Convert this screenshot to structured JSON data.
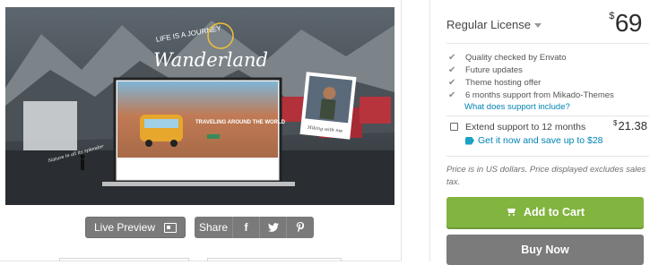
{
  "preview": {
    "brand_tagline": "LIFE IS A JOURNEY",
    "brand_title": "Wanderland",
    "screen_headline": "TRAVELING AROUND THE WORLD",
    "photo_caption": "Hiking with me",
    "left_caption": "Nature in all its splendor"
  },
  "actions": {
    "live_preview_label": "Live Preview",
    "share_label": "Share",
    "facebook_glyph": "f",
    "twitter_glyph": "❀",
    "pinterest_glyph": "℗"
  },
  "license": {
    "name": "Regular License",
    "currency": "$",
    "price": "69",
    "features": [
      "Quality checked by Envato",
      "Future updates",
      "Theme hosting offer",
      "6 months support from Mikado-Themes"
    ],
    "support_link": "What does support include?",
    "extend_label": "Extend support to 12 months",
    "extend_currency": "$",
    "extend_price": "21.38",
    "extend_offer": "Get it now and save up to $28",
    "note": "Price is in US dollars. Price displayed excludes sales tax.",
    "add_to_cart_label": "Add to Cart",
    "buy_now_label": "Buy Now"
  },
  "colors": {
    "accent_green": "#82b440",
    "link_blue": "#0084b4",
    "button_grey": "#7a7a7a"
  }
}
